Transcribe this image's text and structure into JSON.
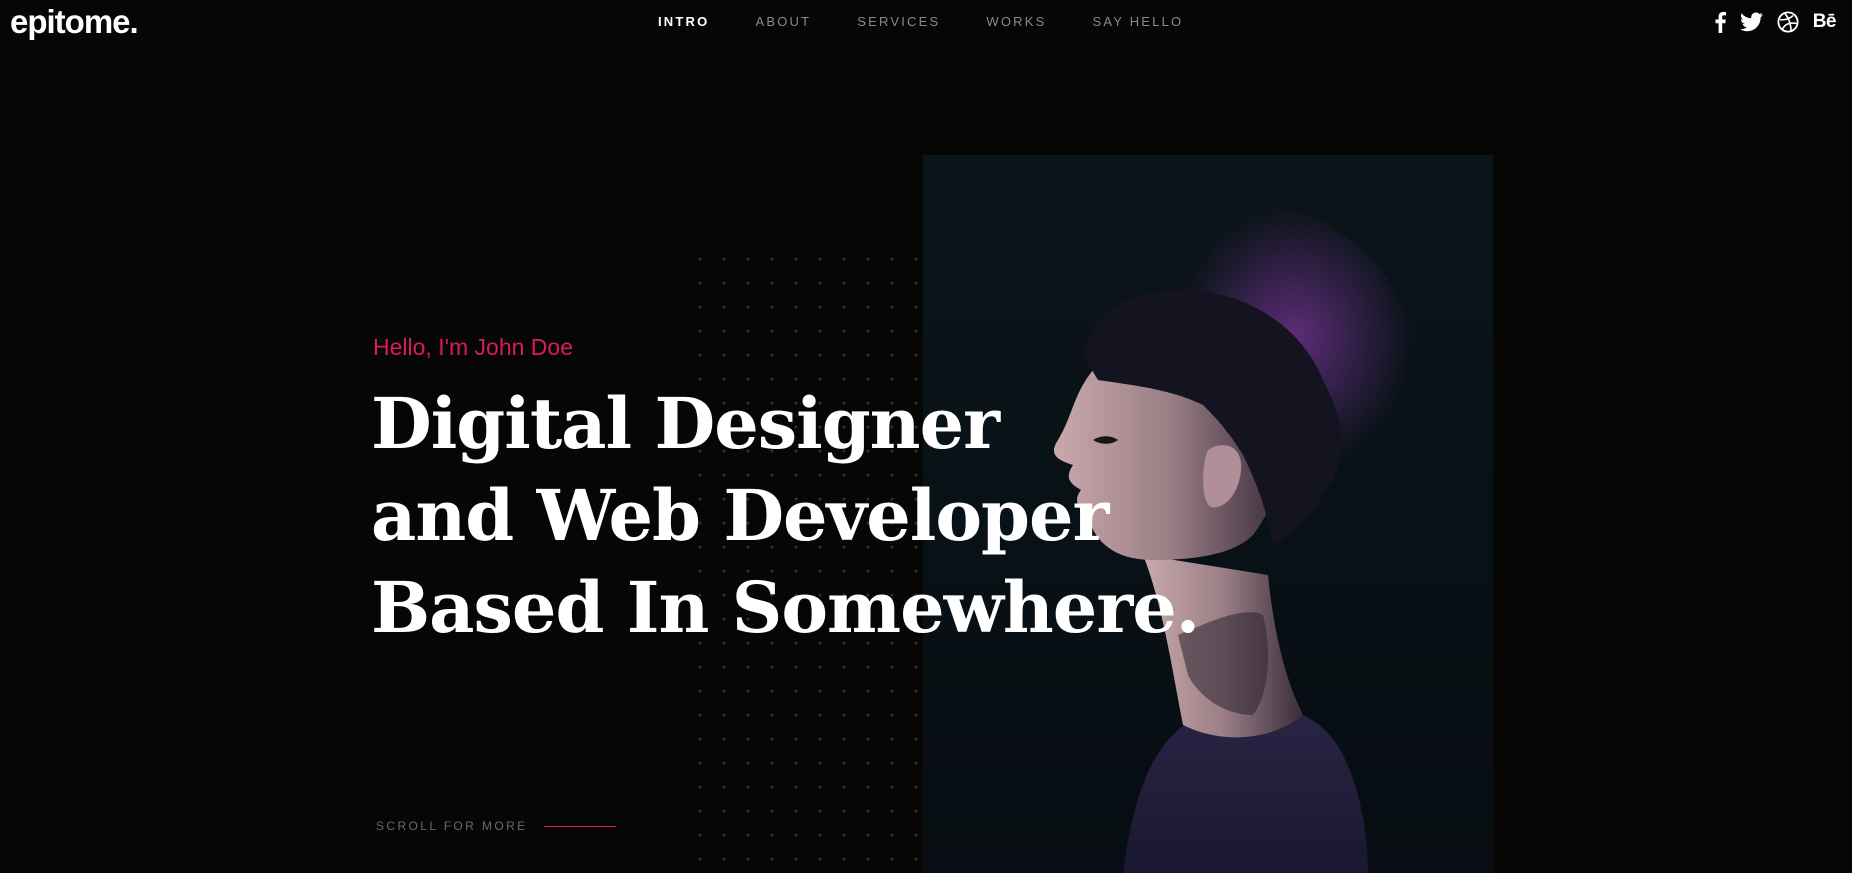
{
  "header": {
    "logo": "epitome.",
    "nav": [
      {
        "label": "INTRO",
        "active": true
      },
      {
        "label": "ABOUT",
        "active": false
      },
      {
        "label": "SERVICES",
        "active": false
      },
      {
        "label": "WORKS",
        "active": false
      },
      {
        "label": "SAY HELLO",
        "active": false
      }
    ],
    "social": [
      {
        "icon": "facebook-icon"
      },
      {
        "icon": "twitter-icon"
      },
      {
        "icon": "dribbble-icon"
      },
      {
        "icon": "behance-icon",
        "text": "Bē"
      }
    ]
  },
  "hero": {
    "greeting": "Hello, I'm John Doe",
    "headline": [
      "Digital Designer",
      "and Web Developer",
      "Based In Somewhere."
    ],
    "scroll_label": "SCROLL FOR MORE"
  },
  "colors": {
    "background": "#060606",
    "accent": "#d81b60",
    "text": "#ffffff",
    "nav_inactive": "#8a8a8a"
  }
}
